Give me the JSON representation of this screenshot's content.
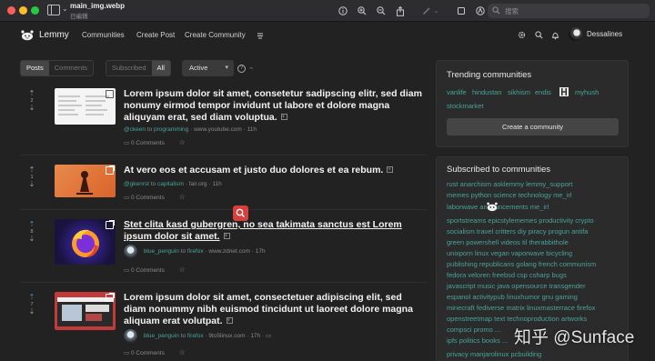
{
  "window": {
    "file_name": "main_img.webp",
    "file_status": "已编辑",
    "search_placeholder": "搜索"
  },
  "navbar": {
    "brand": "Lemmy",
    "links": [
      "Communities",
      "Create Post",
      "Create Community"
    ],
    "username": "Dessalines"
  },
  "filters": {
    "view_type": [
      "Posts",
      "Comments"
    ],
    "listing": [
      "Subscribed",
      "All"
    ],
    "sort": "Active"
  },
  "posts": [
    {
      "score": "2",
      "title": "Lorem ipsum dolor sit amet, consetetur sadipscing elitr, sed diam nonumy eirmod tempor invidunt ut labore et dolore magna aliquyam erat, sed diam voluptua.",
      "author": "@ckeen",
      "community": "programming",
      "domain": "www.youtube.com",
      "age": "11h",
      "comments": "0 Comments",
      "has_avatar": false
    },
    {
      "score": "1",
      "title": "At vero eos et accusam et justo duo dolores et ea rebum.",
      "author": "@gkenrst",
      "community": "capitalism",
      "domain": "fair.org",
      "age": "11h",
      "comments": "0 Comments",
      "has_avatar": false
    },
    {
      "score": "8",
      "title": "Stet clita kasd gubergren, no sea takimata sanctus est Lorem ipsum dolor sit amet.",
      "author": "blue_penguin",
      "community": "firefox",
      "domain": "www.zdnet.com",
      "age": "17h",
      "comments": "0 Comments",
      "has_avatar": true
    },
    {
      "score": "7",
      "title": "Lorem ipsum dolor sit amet, consectetuer adipiscing elit, sed diam nonummy nibh euismod tincidunt ut laoreet dolore magna aliquam erat volutpat.",
      "author": "blue_penguin",
      "community": "firefox",
      "domain": "9to5linux.com",
      "age": "17h",
      "comments": "0 Comments",
      "has_avatar": true
    }
  ],
  "labels": {
    "to": "to",
    "bullet": "·"
  },
  "trending": {
    "title": "Trending communities",
    "items": [
      "vanlife",
      "hindustan",
      "sikhism",
      "endis",
      "myhush",
      "stockmarket"
    ],
    "create_button": "Create a community"
  },
  "subscribed": {
    "title": "Subscribed to communities",
    "lines": [
      "rust  anarchism  asklemmy  lemmy_support",
      "memes  python  science  technology  me_irl",
      "laborwave        announcements  me_irl",
      "sportstreams  epicstylememes  productivity  crypto",
      "socialism  travel  critters  diy  piracy  progun  antifa",
      "green  powershell  videos  til  therabbithole",
      "unixporn  linux  vegan  vaporwave  bicycling",
      "publishing  republicans  golang  french  communism",
      "fedora  veloren  freebsd  csp  csharp  bugs",
      "javascript  music  java  opensource  transgender",
      "espanol  activitypub  linuxhumor  gnu  gaming",
      "minecraft  fediverse  matrix  linuxmasterrace  firefox",
      "openstreetmap  text  technoproduction  artworks",
      "compsci  promo  ...",
      "ipfs  politics  books  ...",
      "privacy  manjarolinux  pcbuilding"
    ]
  },
  "watermark": "知乎 @Sunface"
}
